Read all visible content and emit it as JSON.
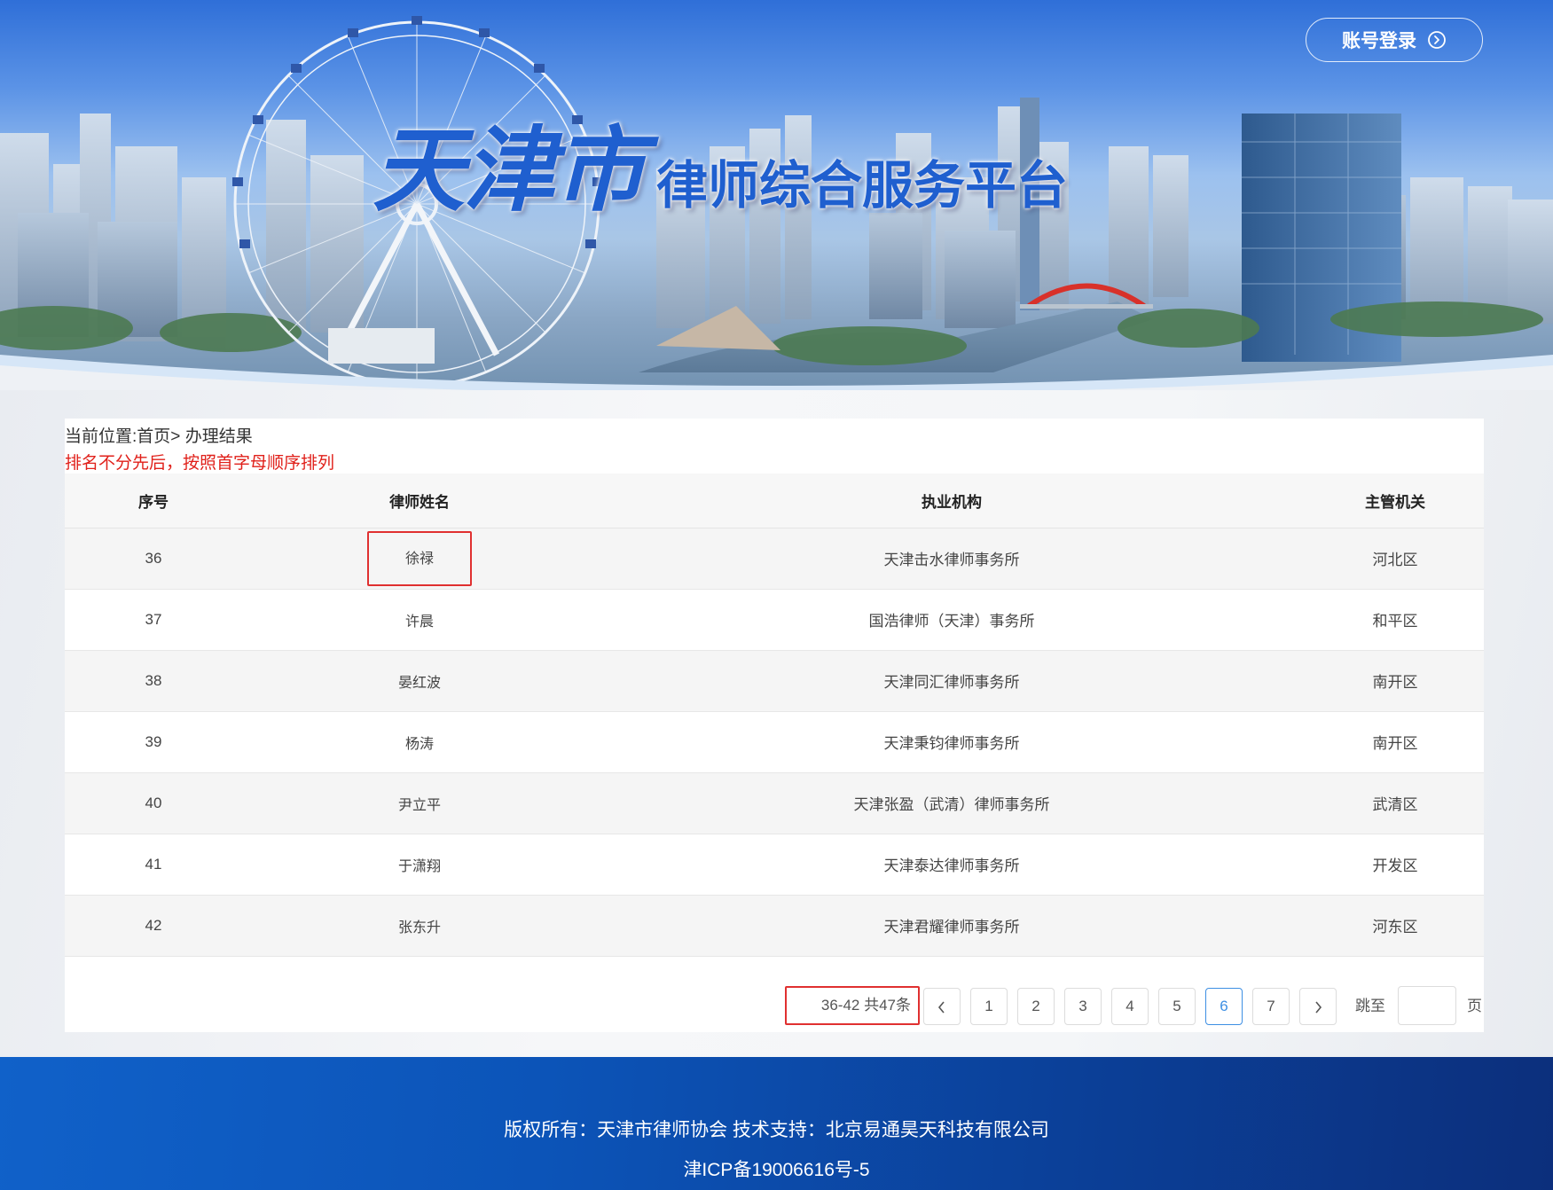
{
  "header": {
    "title_city": "天津市",
    "title_platform": "律师综合服务平台",
    "login_label": "账号登录",
    "login_icon": "circle-chevron-right-icon"
  },
  "breadcrumb": {
    "prefix": "当前位置:",
    "home": "首页",
    "separator": ">",
    "current": "办理结果"
  },
  "note": "排名不分先后，按照首字母顺序排列",
  "table": {
    "columns": [
      "序号",
      "律师姓名",
      "执业机构",
      "主管机关"
    ],
    "rows": [
      {
        "no": "36",
        "name": "徐禄",
        "firm": "天津击水律师事务所",
        "authority": "河北区"
      },
      {
        "no": "37",
        "name": "许晨",
        "firm": "国浩律师（天津）事务所",
        "authority": "和平区"
      },
      {
        "no": "38",
        "name": "晏红波",
        "firm": "天津同汇律师事务所",
        "authority": "南开区"
      },
      {
        "no": "39",
        "name": "杨涛",
        "firm": "天津秉钧律师事务所",
        "authority": "南开区"
      },
      {
        "no": "40",
        "name": "尹立平",
        "firm": "天津张盈（武清）律师事务所",
        "authority": "武清区"
      },
      {
        "no": "41",
        "name": "于潇翔",
        "firm": "天津泰达律师事务所",
        "authority": "开发区"
      },
      {
        "no": "42",
        "name": "张东升",
        "firm": "天津君耀律师事务所",
        "authority": "河东区"
      }
    ]
  },
  "pagination": {
    "total_text": "36-42 共47条",
    "prev_icon": "chevron-left-icon",
    "next_icon": "chevron-right-icon",
    "pages": [
      "1",
      "2",
      "3",
      "4",
      "5",
      "6",
      "7"
    ],
    "current_page": "6",
    "jump_label": "跳至",
    "jump_value": "",
    "page_suffix": "页"
  },
  "footer": {
    "line1": "版权所有：天津市律师协会 技术支持：北京易通昊天科技有限公司",
    "line2": "津ICP备19006616号-5"
  },
  "colors": {
    "accent": "#3d8fe3",
    "highlight_box": "#e03030",
    "note_red": "#e0201a",
    "footer_blue": "#0c54b8",
    "title_blue": "#1f5fcf"
  }
}
